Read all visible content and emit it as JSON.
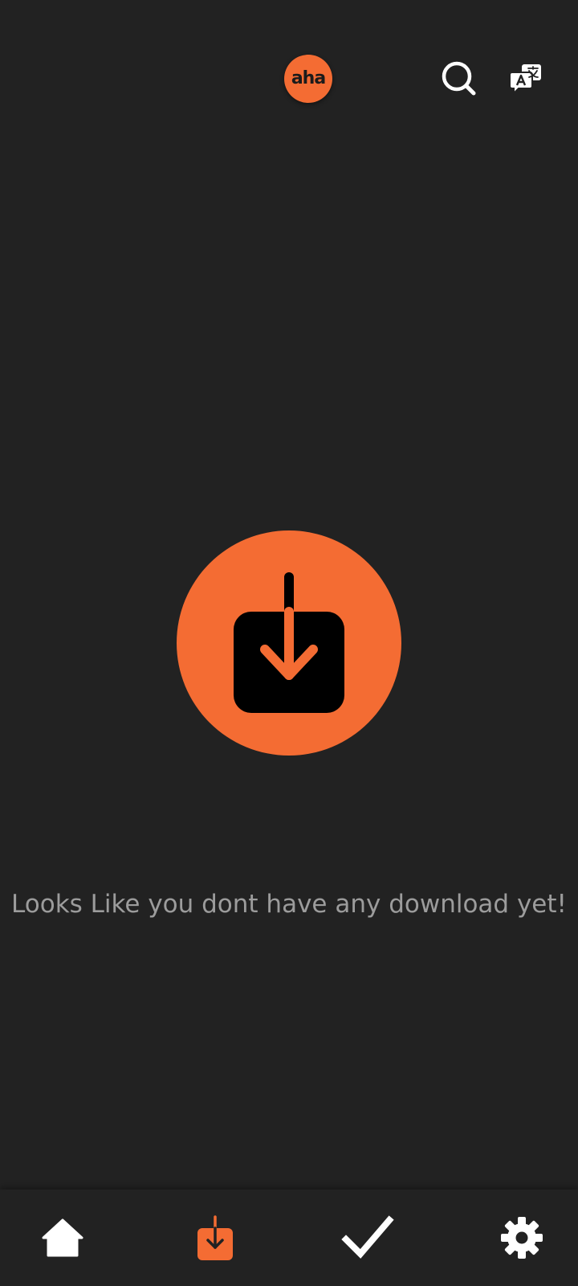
{
  "header": {
    "logo_text": "aha",
    "search_icon": "search-icon",
    "language_icon": "translate-icon"
  },
  "empty_state": {
    "icon": "download-icon",
    "message": "Looks Like you dont have any download yet!"
  },
  "bottom_nav": {
    "items": [
      {
        "name": "home",
        "icon": "home-icon",
        "active": false
      },
      {
        "name": "downloads",
        "icon": "download-icon",
        "active": true
      },
      {
        "name": "watched",
        "icon": "checkmark-icon",
        "active": false
      },
      {
        "name": "settings",
        "icon": "gear-icon",
        "active": false
      }
    ]
  },
  "colors": {
    "background": "#222222",
    "accent": "#f46c33",
    "text_muted": "#9c9c9c",
    "icon": "#ffffff"
  }
}
